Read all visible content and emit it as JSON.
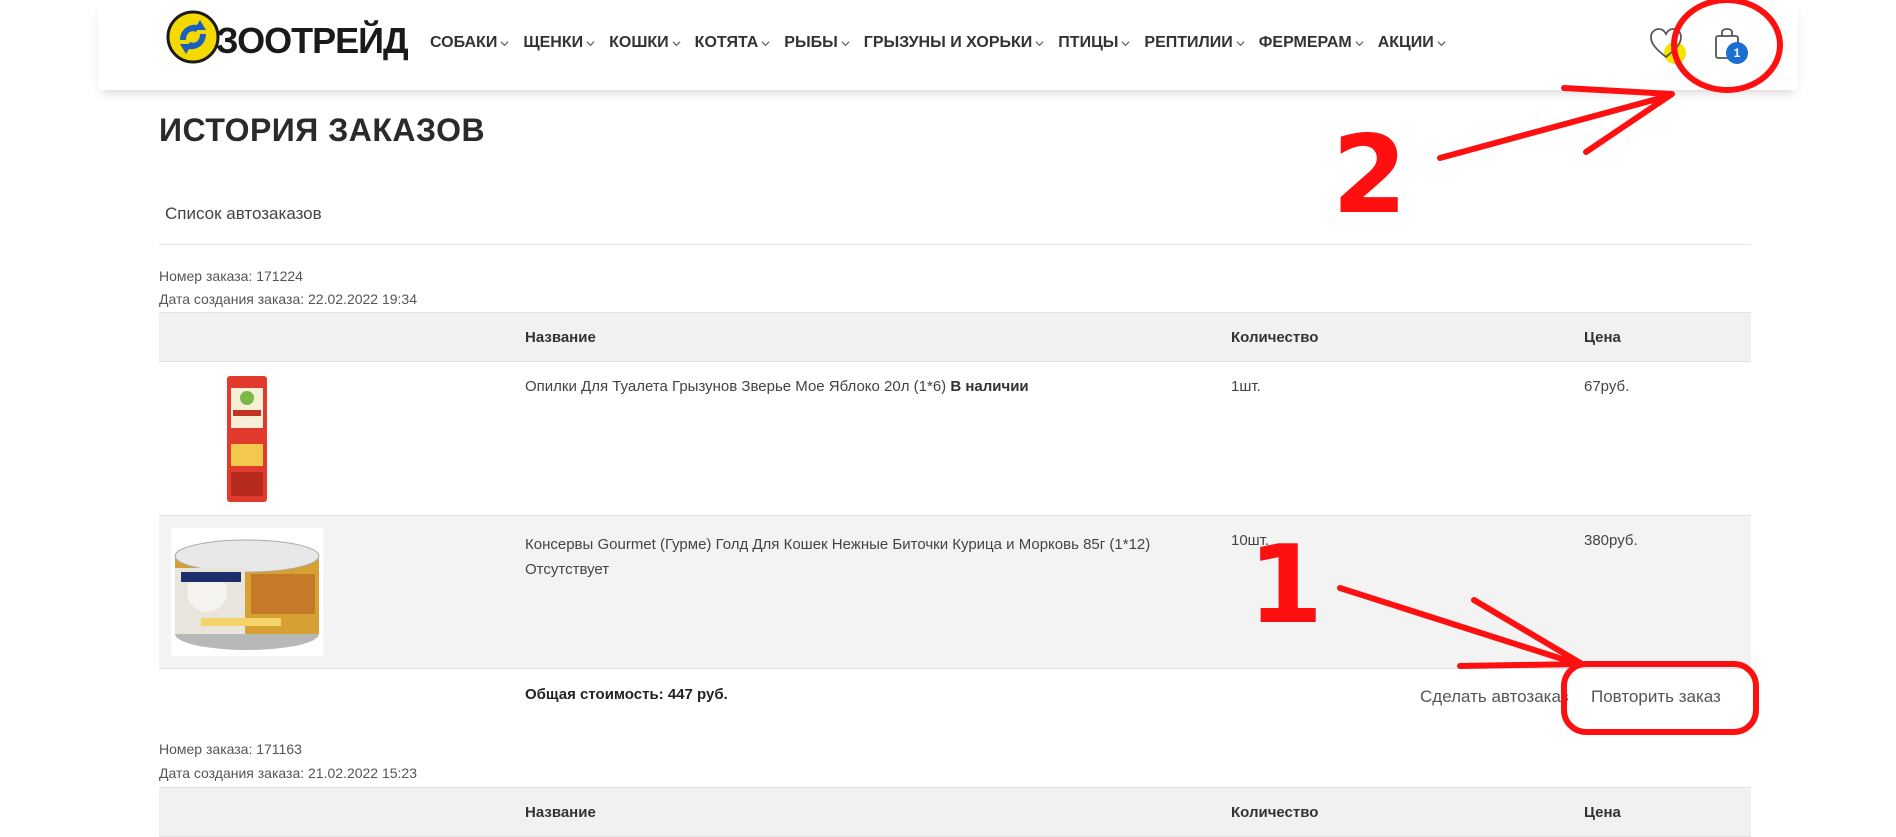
{
  "brand": {
    "name": "ЗООТРЕЙД"
  },
  "nav": {
    "items": [
      {
        "label": "СОБАКИ"
      },
      {
        "label": "ЩЕНКИ"
      },
      {
        "label": "КОШКИ"
      },
      {
        "label": "КОТЯТА"
      },
      {
        "label": "РЫБЫ"
      },
      {
        "label": "ГРЫЗУНЫ И ХОРЬКИ"
      },
      {
        "label": "ПТИЦЫ"
      },
      {
        "label": "РЕПТИЛИИ"
      },
      {
        "label": "ФЕРМЕРАМ"
      },
      {
        "label": "АКЦИИ"
      }
    ]
  },
  "header": {
    "cart_count": "1",
    "accent": "#1a6fd0"
  },
  "page": {
    "title": "ИСТОРИЯ ЗАКАЗОВ",
    "autoorders_link": "Список автозаказов"
  },
  "orders": [
    {
      "number_line": "Номер заказа: 171224",
      "date_line": "Дата создания заказа: 22.02.2022 19:34",
      "columns": {
        "name": "Название",
        "qty": "Количество",
        "price": "Цена"
      },
      "items": [
        {
          "name": "Опилки Для Туалета Грызунов Зверье Мое Яблоко 20л (1*6)",
          "status": "В наличии",
          "qty": "1шт.",
          "price": "67руб."
        },
        {
          "name": "Консервы Gourmet (Гурме) Голд Для Кошек Нежные Биточки Курица и Морковь 85г (1*12)",
          "status": "Отсутствует",
          "qty": "10шт.",
          "price": "380руб."
        }
      ],
      "total": "Общая стоимость: 447 руб.",
      "auto_button": "Сделать автозаказ",
      "repeat_button": "Повторить заказ"
    },
    {
      "number_line": "Номер заказа: 171163",
      "date_line": "Дата создания заказа: 21.02.2022 15:23",
      "columns": {
        "name": "Название",
        "qty": "Количество",
        "price": "Цена"
      }
    }
  ],
  "annotations": {
    "step1": "1",
    "step2": "2",
    "color": "#ff1010"
  }
}
